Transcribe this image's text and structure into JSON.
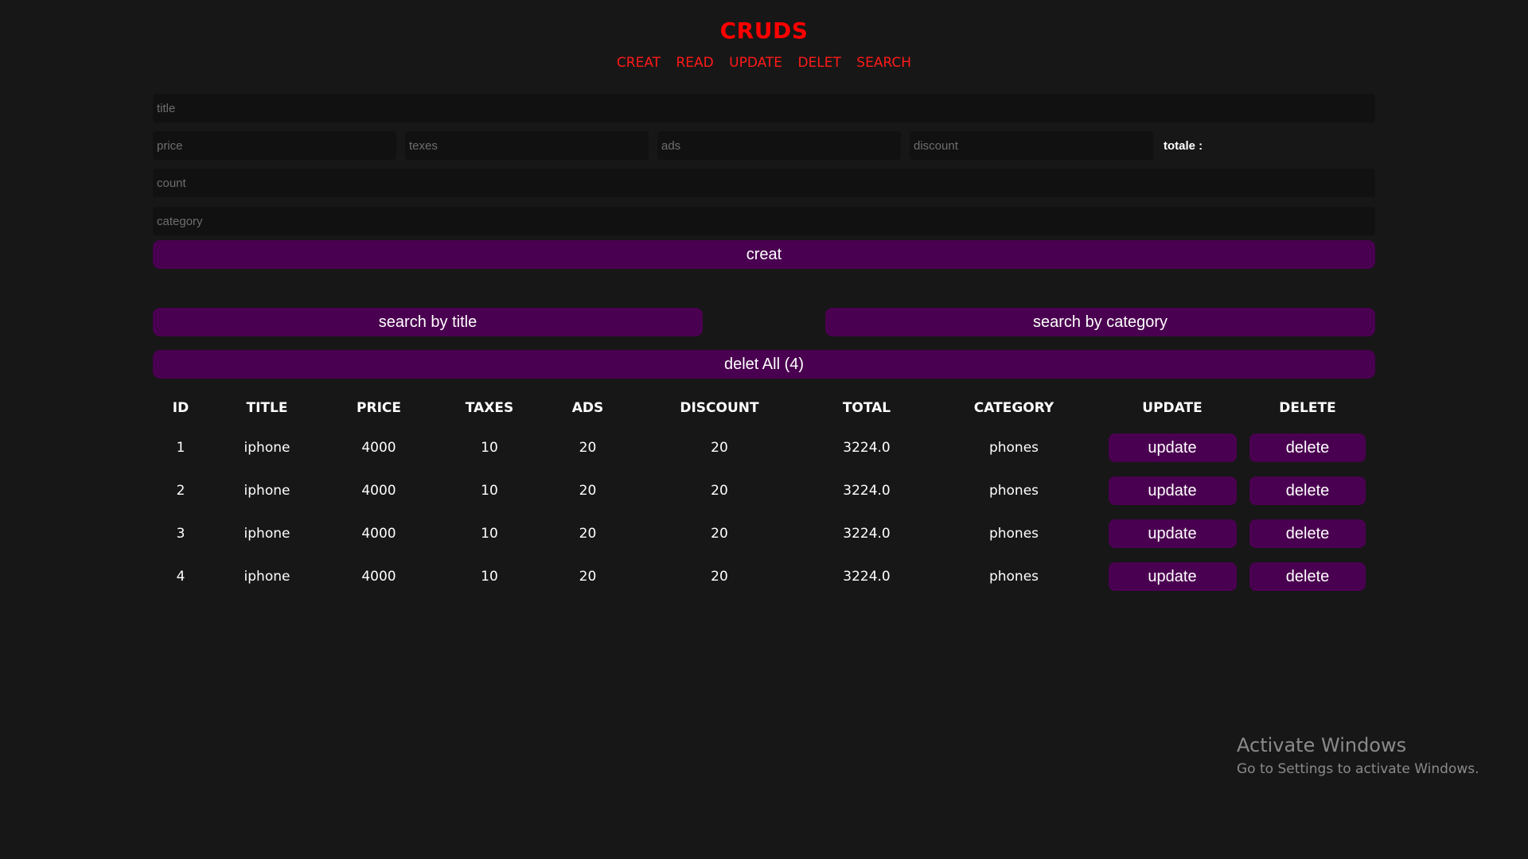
{
  "header": {
    "title": "CRUDS",
    "nav": [
      "CREAT",
      "READ",
      "UPDATE",
      "DELET",
      "SEARCH"
    ]
  },
  "form": {
    "title_placeholder": "title",
    "price_placeholder": "price",
    "taxes_placeholder": "texes",
    "ads_placeholder": "ads",
    "discount_placeholder": "discount",
    "total_label": "totale :",
    "count_placeholder": "count",
    "category_placeholder": "category",
    "create_label": "creat"
  },
  "search": {
    "by_title_label": "search by title",
    "by_category_label": "search by category"
  },
  "delete_all_label": "delet All (4)",
  "table": {
    "headers": [
      "ID",
      "TITLE",
      "PRICE",
      "TAXES",
      "ADS",
      "DISCOUNT",
      "TOTAL",
      "CATEGORY",
      "UPDATE",
      "DELETE"
    ],
    "update_label": "update",
    "delete_label": "delete",
    "rows": [
      {
        "id": "1",
        "title": "iphone",
        "price": "4000",
        "taxes": "10",
        "ads": "20",
        "discount": "20",
        "total": "3224.0",
        "category": "phones"
      },
      {
        "id": "2",
        "title": "iphone",
        "price": "4000",
        "taxes": "10",
        "ads": "20",
        "discount": "20",
        "total": "3224.0",
        "category": "phones"
      },
      {
        "id": "3",
        "title": "iphone",
        "price": "4000",
        "taxes": "10",
        "ads": "20",
        "discount": "20",
        "total": "3224.0",
        "category": "phones"
      },
      {
        "id": "4",
        "title": "iphone",
        "price": "4000",
        "taxes": "10",
        "ads": "20",
        "discount": "20",
        "total": "3224.0",
        "category": "phones"
      }
    ]
  },
  "watermark": {
    "line1": "Activate Windows",
    "line2": "Go to Settings to activate Windows."
  },
  "colors": {
    "background": "#171717",
    "accent_red": "#ff0000",
    "button_purple": "#4a0050"
  }
}
